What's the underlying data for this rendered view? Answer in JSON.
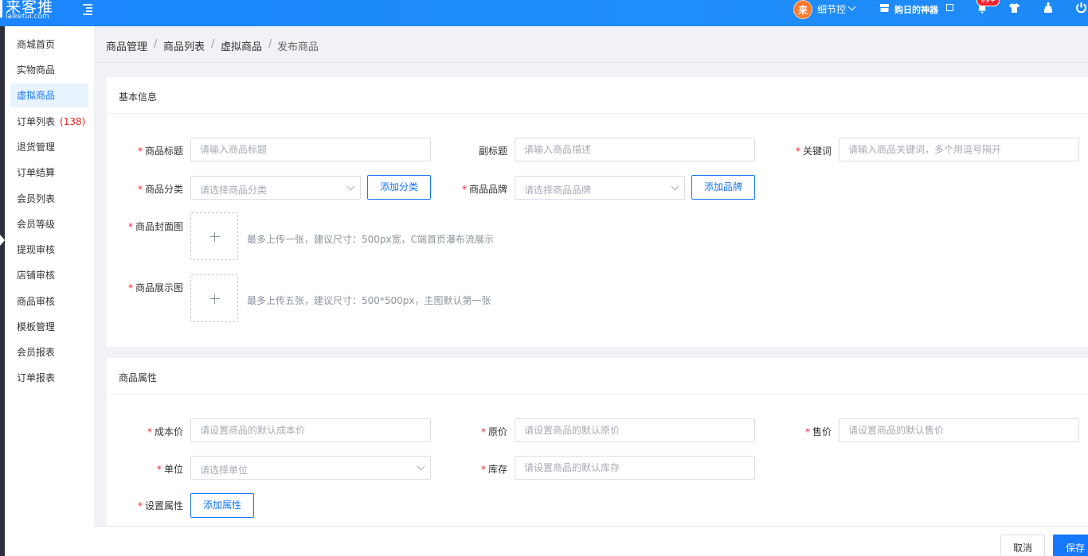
{
  "header": {
    "logo_text": "来客推",
    "logo_sub": "laiketui.com",
    "avatar_char": "来",
    "user_name": "细节控",
    "tool_label": "购日的神器",
    "badge": "99+"
  },
  "sidebar": {
    "items": [
      {
        "label": "商城首页"
      },
      {
        "label": "实物商品"
      },
      {
        "label": "虚拟商品"
      },
      {
        "label": "订单列表",
        "count": "(138)"
      },
      {
        "label": "退货管理"
      },
      {
        "label": "订单结算"
      },
      {
        "label": "会员列表"
      },
      {
        "label": "会员等级"
      },
      {
        "label": "提现审核"
      },
      {
        "label": "店铺审核"
      },
      {
        "label": "商品审核"
      },
      {
        "label": "模板管理"
      },
      {
        "label": "会员报表"
      },
      {
        "label": "订单报表"
      }
    ]
  },
  "breadcrumb": [
    "商品管理",
    "商品列表",
    "虚拟商品",
    "发布商品"
  ],
  "basic": {
    "title": "基本信息",
    "product_title_label": "商品标题",
    "product_title_placeholder": "请输入商品标题",
    "subtitle_label": "副标题",
    "subtitle_placeholder": "请输入商品描述",
    "keywords_label": "关键词",
    "keywords_placeholder": "请输入商品关键词，多个用逗号隔开",
    "category_label": "商品分类",
    "category_placeholder": "请选择商品分类",
    "add_category": "添加分类",
    "brand_label": "商品品牌",
    "brand_placeholder": "请选择商品品牌",
    "add_brand": "添加品牌",
    "cover_label": "商品封面图",
    "cover_hint": "最多上传一张，建议尺寸：500px宽，C端首页瀑布流展示",
    "gallery_label": "商品展示图",
    "gallery_hint": "最多上传五张，建议尺寸：500*500px，主图默认第一张"
  },
  "attrs": {
    "title": "商品属性",
    "cost_label": "成本价",
    "cost_placeholder": "请设置商品的默认成本价",
    "original_label": "原价",
    "original_placeholder": "请设置商品的默认原价",
    "price_label": "售价",
    "price_placeholder": "请设置商品的默认售价",
    "unit_label": "单位",
    "unit_placeholder": "请选择单位",
    "stock_label": "库存",
    "stock_placeholder": "请设置商品的默认库存",
    "setting_label": "设置属性",
    "add_attr": "添加属性"
  },
  "footer": {
    "cancel": "取消",
    "save": "保存"
  }
}
